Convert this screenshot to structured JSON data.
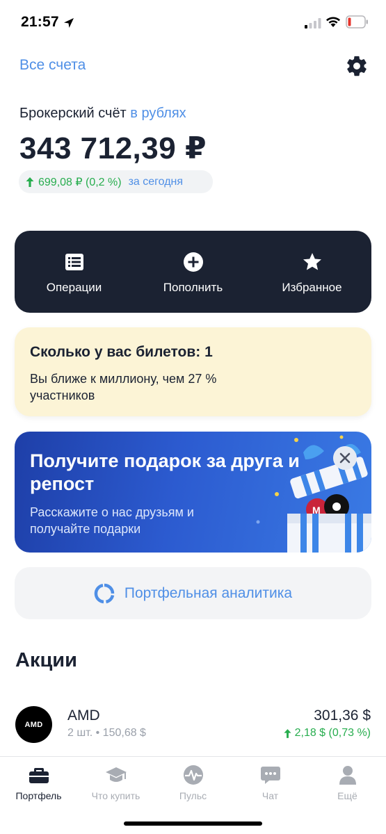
{
  "status_bar": {
    "time": "21:57"
  },
  "header": {
    "all_accounts": "Все счета"
  },
  "account": {
    "title": "Брокерский счёт",
    "currency_link": "в рублях",
    "balance": "343 712,39 ₽",
    "change_value": "699,08 ₽ (0,2 %)",
    "change_period": "за сегодня"
  },
  "actions": [
    {
      "label": "Операции",
      "icon": "list-icon"
    },
    {
      "label": "Пополнить",
      "icon": "plus-circle-icon"
    },
    {
      "label": "Избранное",
      "icon": "star-icon"
    }
  ],
  "tickets": {
    "title": "Сколько у вас билетов: 1",
    "text": "Вы ближе к миллиону, чем 27 % участников"
  },
  "promo": {
    "title": "Получите подарок за друга и репост",
    "text": "Расскажите о нас друзьям и получайте подарки"
  },
  "analytics": {
    "label": "Портфельная аналитика"
  },
  "stocks": {
    "section_title": "Акции",
    "items": [
      {
        "logo_text": "AMD",
        "name": "AMD",
        "sub": "2 шт. • 150,68 $",
        "price": "301,36 $",
        "change": "2,18 $ (0,73 %)"
      }
    ]
  },
  "tabbar": {
    "items": [
      {
        "label": "Портфель",
        "icon": "briefcase-icon",
        "active": true
      },
      {
        "label": "Что купить",
        "icon": "graduation-cap-icon",
        "active": false
      },
      {
        "label": "Пульс",
        "icon": "pulse-icon",
        "active": false
      },
      {
        "label": "Чат",
        "icon": "chat-icon",
        "active": false
      },
      {
        "label": "Ещё",
        "icon": "profile-icon",
        "active": false
      }
    ]
  },
  "colors": {
    "accent": "#4f8fe6",
    "dark": "#1b2232",
    "positive": "#27ad4e",
    "tickets_bg": "#fcf4d6",
    "promo_bg": "#2c5bd0"
  }
}
